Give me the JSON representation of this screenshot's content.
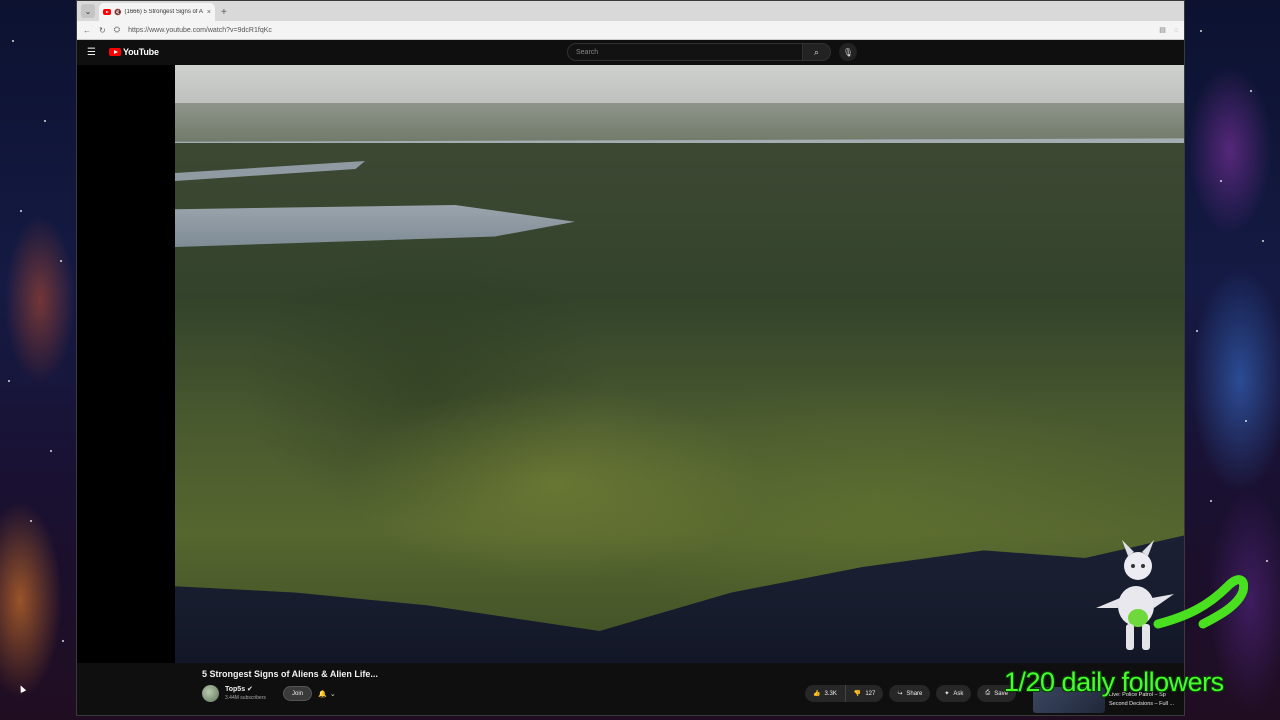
{
  "browser": {
    "tab_title": "(1666) 5 Strongest Signs of A",
    "tab_close": "×",
    "new_tab": "+",
    "url": "https://www.youtube.com/watch?v=9dcR1fqKc"
  },
  "youtube": {
    "logo_text": "YouTube",
    "search_placeholder": "Search"
  },
  "video": {
    "title": "5 Strongest Signs of Aliens & Alien Life...",
    "channel_name": "Top5s ✔",
    "subscribers": "3.44M subscribers",
    "join_label": "Join",
    "likes": "3.3K",
    "dislikes": "127",
    "share_label": "Share",
    "ask_label": "Ask",
    "save_label": "Save"
  },
  "up_next": {
    "line1": "Live: Police Patrol – Sp",
    "line2": "Second Decisions – Full ..."
  },
  "overlay": {
    "followers_text": "1/20 daily followers"
  },
  "colors": {
    "youtube_red": "#ff0000",
    "overlay_green": "#44ff2a",
    "page_bg": "#0f0f0f"
  }
}
